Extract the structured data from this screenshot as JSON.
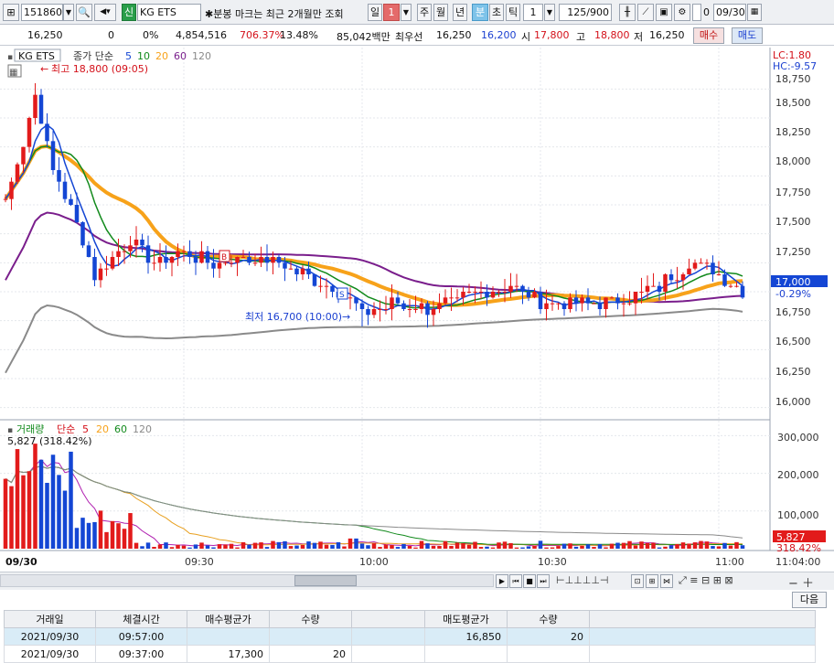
{
  "toolbar": {
    "code": "151860",
    "stock_name": "KG ETS",
    "credit_tag": "신",
    "notice": "분봉 마크는 최근 2개월만 조회",
    "periods": [
      "일",
      "주",
      "월",
      "년",
      "분",
      "초",
      "틱"
    ],
    "day_value": "1",
    "minute_value": "1",
    "count": "125/900",
    "date": "09/30",
    "check_label": "0"
  },
  "quote": {
    "price": "16,250",
    "change": "0",
    "change_pct": "0%",
    "volume": "4,854,516",
    "vol_ratio": "706.37%",
    "turnover": "13.48%",
    "amount": "85,042백만",
    "best_ask_label": "최우선",
    "best_ask": "16,250",
    "best_bid": "16,200",
    "open_label": "시",
    "open": "17,800",
    "high_label": "고",
    "high": "18,800",
    "low_label": "저",
    "low": "16,250",
    "buy_label": "매수",
    "sell_label": "매도"
  },
  "chart": {
    "stock_tag": "KG ETS",
    "ma_label": "종가 단순",
    "ma_periods": [
      "5",
      "10",
      "20",
      "60",
      "120"
    ],
    "high_note": "최고 18,800 (09:05)",
    "low_note": "최저 16,700 (10:00)",
    "lc": "LC:1.80",
    "hc": "HC:-9.57",
    "price_ticks": [
      "18,750",
      "18,500",
      "18,250",
      "18,000",
      "17,750",
      "17,500",
      "17,250",
      "16,750",
      "16,500",
      "16,250",
      "16,000"
    ],
    "current_price": "17,000",
    "current_pct": "-0.29%",
    "vol_label": "거래량",
    "vol_ma_label": "단순",
    "vol_ma_periods": [
      "5",
      "20",
      "60",
      "120"
    ],
    "vol_current": "5,827",
    "vol_note": "5,827 (318.42%)",
    "vol_pct": "318.42%",
    "vol_ticks": [
      "300,000",
      "200,000",
      "100,000"
    ],
    "time_ticks": [
      "09/30",
      "09:30",
      "10:00",
      "10:30",
      "11:00",
      "11:04:00"
    ],
    "buy_marker": "B",
    "sell_marker": "S",
    "colors": {
      "up": "#e21b1b",
      "down": "#1446d4",
      "ma5": "#1446d4",
      "ma10": "#128a1c",
      "ma20": "#f7a21a",
      "ma60": "#7a1e8c",
      "ma120": "#8a8a8a"
    }
  },
  "chart_data": {
    "type": "candlestick",
    "time_range": [
      "09:00",
      "11:04"
    ],
    "price": {
      "open": 17800,
      "high": 18800,
      "low": 16700,
      "close": 17000,
      "high_time": "09:05",
      "low_time": "10:00",
      "close_path": [
        [
          "09:00",
          17800
        ],
        [
          "09:03",
          18300
        ],
        [
          "09:05",
          18700
        ],
        [
          "09:08",
          18050
        ],
        [
          "09:12",
          17600
        ],
        [
          "09:15",
          17150
        ],
        [
          "09:18",
          17300
        ],
        [
          "09:21",
          17450
        ],
        [
          "09:25",
          17250
        ],
        [
          "09:30",
          17350
        ],
        [
          "09:35",
          17250
        ],
        [
          "09:40",
          17300
        ],
        [
          "09:45",
          17250
        ],
        [
          "09:50",
          17150
        ],
        [
          "09:55",
          17050
        ],
        [
          "09:58",
          16950
        ],
        [
          "10:00",
          16800
        ],
        [
          "10:05",
          16900
        ],
        [
          "10:10",
          16850
        ],
        [
          "10:15",
          16900
        ],
        [
          "10:20",
          17000
        ],
        [
          "10:25",
          17050
        ],
        [
          "10:30",
          16900
        ],
        [
          "10:35",
          16900
        ],
        [
          "10:40",
          16900
        ],
        [
          "10:45",
          16950
        ],
        [
          "10:50",
          17050
        ],
        [
          "10:55",
          17250
        ],
        [
          "11:00",
          17150
        ],
        [
          "11:04",
          17000
        ]
      ]
    },
    "volume_peak": 300000
  },
  "navbar": {
    "next_label": "다음"
  },
  "grid": {
    "headers": [
      "거래일",
      "체결시간",
      "매수평균가",
      "수량",
      "",
      "매도평균가",
      "수량"
    ],
    "rows": [
      [
        "2021/09/30",
        "09:57:00",
        "",
        "",
        "",
        "16,850",
        "20"
      ],
      [
        "2021/09/30",
        "09:37:00",
        "17,300",
        "20",
        "",
        "",
        ""
      ]
    ]
  }
}
